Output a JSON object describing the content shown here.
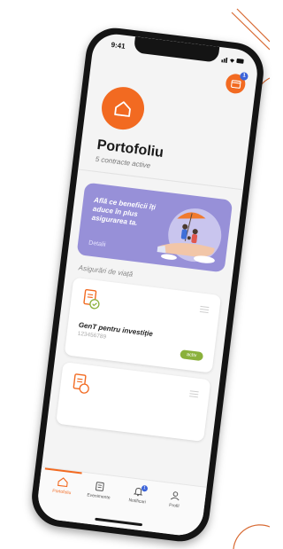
{
  "status_bar": {
    "time": "9:41"
  },
  "header": {
    "card_badge_count": "1",
    "title": "Portofoliu",
    "subtitle": "5 contracte active"
  },
  "promo": {
    "text": "Află ce beneficii îți aduce în plus asigurarea ta.",
    "link": "Detalii"
  },
  "section_title": "Asigurări de viață",
  "policy": {
    "name": "GenT pentru investiție",
    "number": "123456789",
    "status": "activ"
  },
  "nav": {
    "items": [
      {
        "label": "Portofoliu",
        "icon": "home-icon"
      },
      {
        "label": "Evenimente",
        "icon": "document-icon"
      },
      {
        "label": "Notificari",
        "icon": "bell-icon"
      },
      {
        "label": "Profil",
        "icon": "user-icon"
      }
    ],
    "notification_badge": "1"
  },
  "colors": {
    "accent": "#f26a21",
    "promo_bg": "#9790d8",
    "badge": "#3b63d9",
    "status_active": "#8ab13b"
  }
}
